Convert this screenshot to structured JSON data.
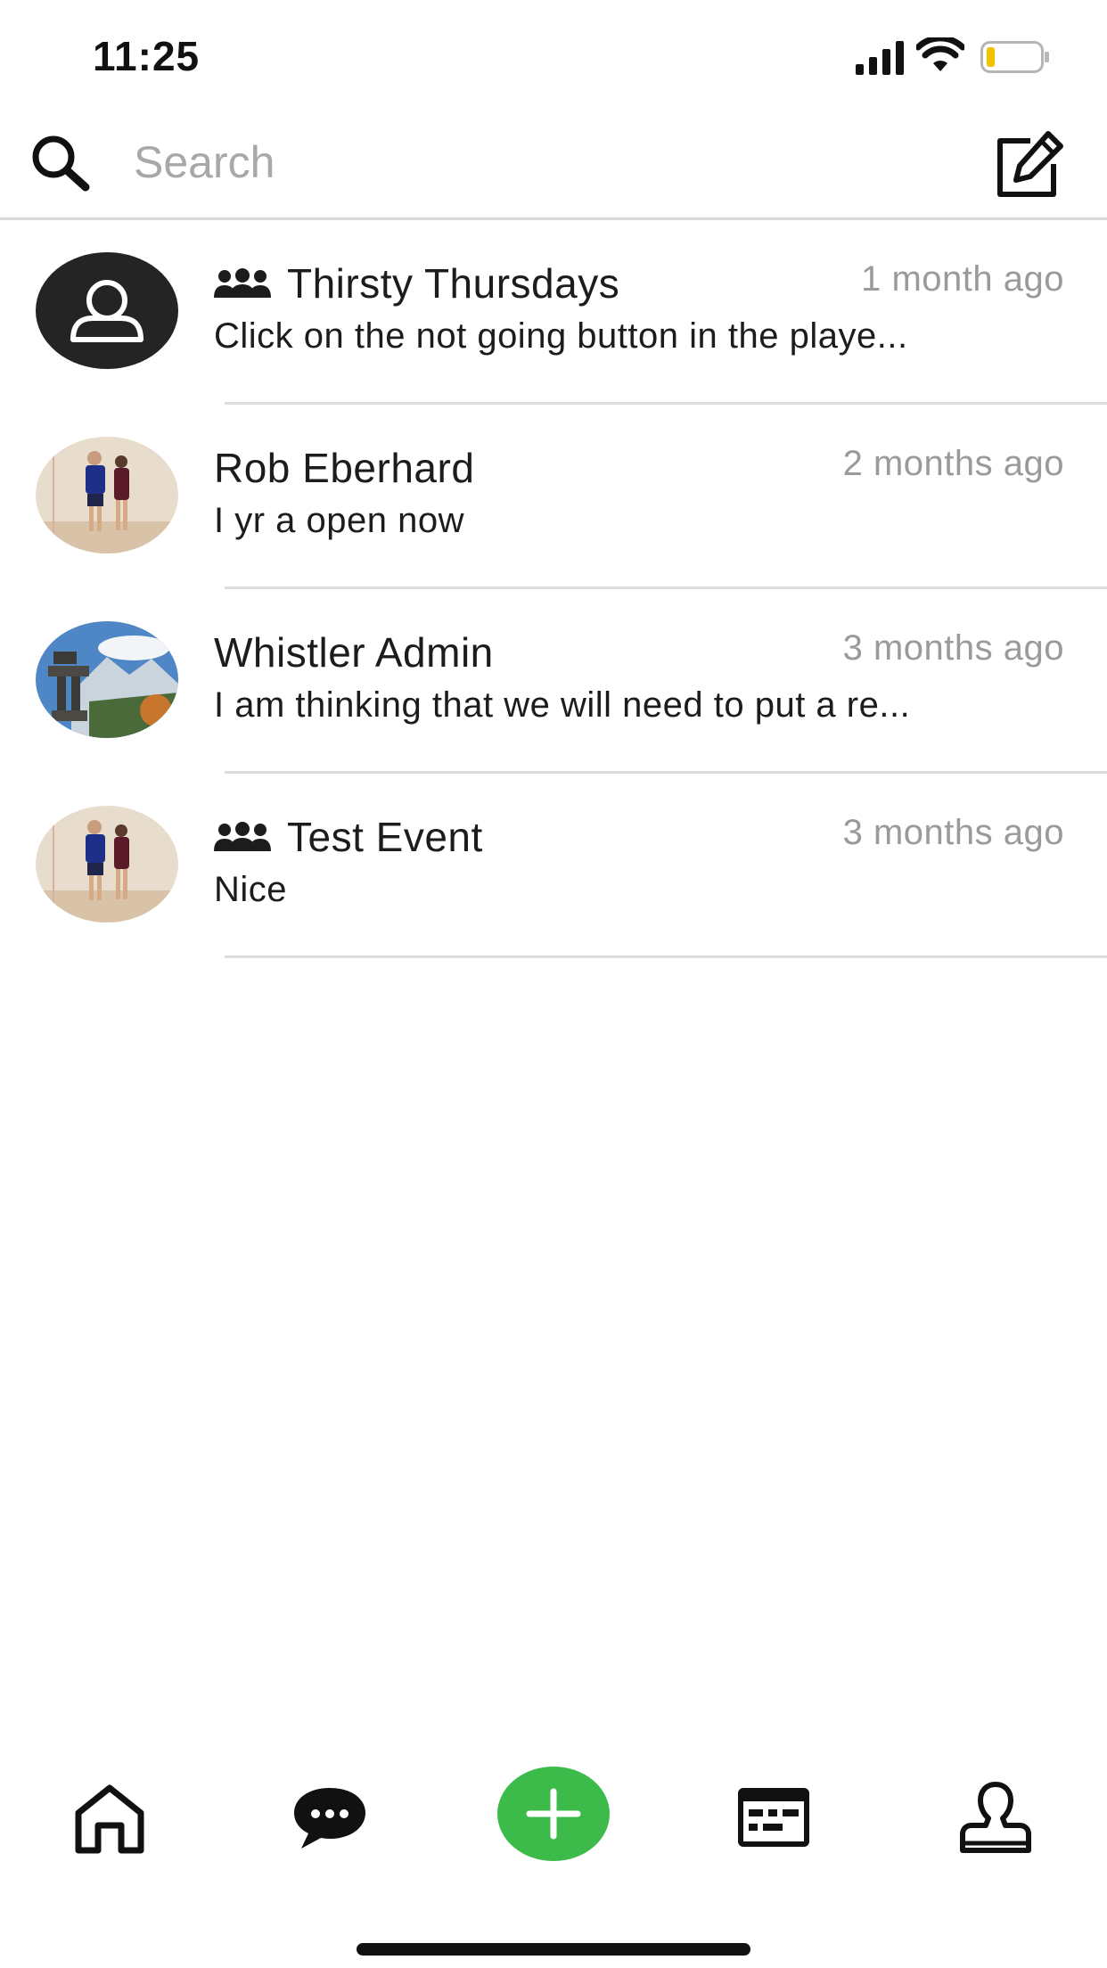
{
  "status_bar": {
    "time": "11:25"
  },
  "search": {
    "placeholder": "Search",
    "value": ""
  },
  "conversations": [
    {
      "title": "Thirsty Thursdays",
      "is_group": true,
      "time": "1 month ago",
      "preview": "Click on the not going button in the playe...",
      "avatar": "default-user-avatar"
    },
    {
      "title": "Rob Eberhard",
      "is_group": false,
      "time": "2 months ago",
      "preview": "I yr a open now",
      "avatar": "couple-photo"
    },
    {
      "title": "Whistler Admin",
      "is_group": false,
      "time": "3 months ago",
      "preview": "I am thinking that we will need to put a re...",
      "avatar": "inukshuk-mountain-photo"
    },
    {
      "title": "Test Event",
      "is_group": true,
      "time": "3 months ago",
      "preview": "Nice",
      "avatar": "couple-photo"
    }
  ],
  "tab_bar": {
    "items": [
      "home-icon",
      "messages-icon",
      "add-icon",
      "schedule-icon",
      "profile-icon"
    ],
    "accent_color": "#3dbb4a"
  },
  "colors": {
    "text": "#1c1c1c",
    "muted": "#9a9a9a",
    "divider": "#dcdcdc",
    "battery_level": "#f2c200"
  }
}
